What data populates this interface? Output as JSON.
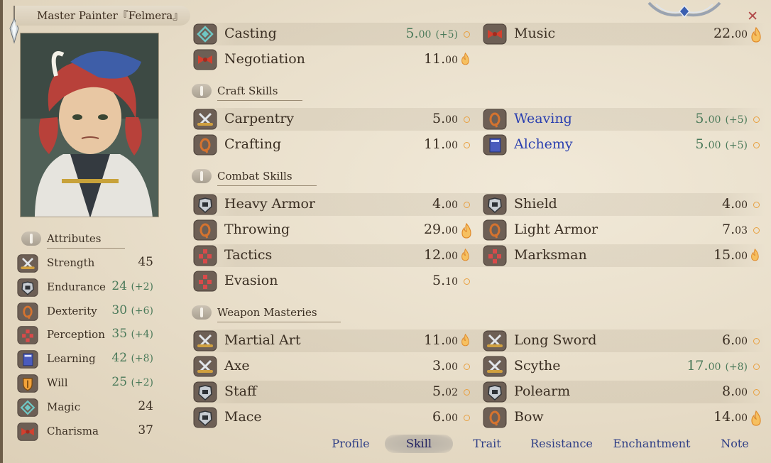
{
  "window": {
    "title": "Master Painter『Felmera』",
    "close_label": "✕"
  },
  "portrait": {
    "name": "character-portrait"
  },
  "attributes": {
    "header": "Attributes",
    "items": [
      {
        "label": "Strength",
        "value": "45",
        "bonus": "",
        "icon": "crossed-swords-icon"
      },
      {
        "label": "Endurance",
        "value": "24",
        "bonus": "(+2)",
        "icon": "armor-icon"
      },
      {
        "label": "Dexterity",
        "value": "30",
        "bonus": "(+6)",
        "icon": "rope-icon"
      },
      {
        "label": "Perception",
        "value": "35",
        "bonus": "(+4)",
        "icon": "target-icon"
      },
      {
        "label": "Learning",
        "value": "42",
        "bonus": "(+8)",
        "icon": "book-icon"
      },
      {
        "label": "Will",
        "value": "25",
        "bonus": "(+2)",
        "icon": "shield-icon"
      },
      {
        "label": "Magic",
        "value": "24",
        "bonus": "",
        "icon": "rune-icon"
      },
      {
        "label": "Charisma",
        "value": "37",
        "bonus": "",
        "icon": "ribbon-icon"
      }
    ]
  },
  "general_skills": [
    {
      "name": "Casting",
      "whole": "5.",
      "dec": "00",
      "bonus": "(+5)",
      "icon": "rune-icon",
      "potential": "low"
    },
    {
      "name": "Music",
      "whole": "22.",
      "dec": "00",
      "bonus": "",
      "icon": "ribbon-icon",
      "potential": "high"
    },
    {
      "name": "Negotiation",
      "whole": "11.",
      "dec": "00",
      "bonus": "",
      "icon": "ribbon-icon",
      "potential": "mid"
    }
  ],
  "sections": {
    "craft": "Craft Skills",
    "combat": "Combat Skills",
    "weapon": "Weapon Masteries"
  },
  "craft_skills": [
    {
      "name": "Carpentry",
      "whole": "5.",
      "dec": "00",
      "bonus": "",
      "icon": "crossed-swords-icon",
      "potential": "low"
    },
    {
      "name": "Weaving",
      "whole": "5.",
      "dec": "00",
      "bonus": "(+5)",
      "icon": "rope-icon",
      "potential": "low",
      "highlight": true
    },
    {
      "name": "Crafting",
      "whole": "11.",
      "dec": "00",
      "bonus": "",
      "icon": "rope-icon",
      "potential": "low"
    },
    {
      "name": "Alchemy",
      "whole": "5.",
      "dec": "00",
      "bonus": "(+5)",
      "icon": "book-icon",
      "potential": "low",
      "highlight": true
    }
  ],
  "combat_skills": [
    {
      "name": "Heavy Armor",
      "whole": "4.",
      "dec": "00",
      "bonus": "",
      "icon": "armor-icon",
      "potential": "low"
    },
    {
      "name": "Shield",
      "whole": "4.",
      "dec": "00",
      "bonus": "",
      "icon": "armor-icon",
      "potential": "low"
    },
    {
      "name": "Throwing",
      "whole": "29.",
      "dec": "00",
      "bonus": "",
      "icon": "rope-icon",
      "potential": "high"
    },
    {
      "name": "Light Armor",
      "whole": "7.",
      "dec": "03",
      "bonus": "",
      "icon": "rope-icon",
      "potential": "low"
    },
    {
      "name": "Tactics",
      "whole": "12.",
      "dec": "00",
      "bonus": "",
      "icon": "target-icon",
      "potential": "mid"
    },
    {
      "name": "Marksman",
      "whole": "15.",
      "dec": "00",
      "bonus": "",
      "icon": "target-icon",
      "potential": "mid"
    },
    {
      "name": "Evasion",
      "whole": "5.",
      "dec": "10",
      "bonus": "",
      "icon": "target-icon",
      "potential": "low"
    }
  ],
  "weapon_skills": [
    {
      "name": "Martial Art",
      "whole": "11.",
      "dec": "00",
      "bonus": "",
      "icon": "crossed-swords-icon",
      "potential": "mid"
    },
    {
      "name": "Long Sword",
      "whole": "6.",
      "dec": "00",
      "bonus": "",
      "icon": "crossed-swords-icon",
      "potential": "low"
    },
    {
      "name": "Axe",
      "whole": "3.",
      "dec": "00",
      "bonus": "",
      "icon": "crossed-swords-icon",
      "potential": "low"
    },
    {
      "name": "Scythe",
      "whole": "17.",
      "dec": "00",
      "bonus": "(+8)",
      "icon": "crossed-swords-icon",
      "potential": "low"
    },
    {
      "name": "Staff",
      "whole": "5.",
      "dec": "02",
      "bonus": "",
      "icon": "armor-icon",
      "potential": "low"
    },
    {
      "name": "Polearm",
      "whole": "8.",
      "dec": "00",
      "bonus": "",
      "icon": "armor-icon",
      "potential": "low"
    },
    {
      "name": "Mace",
      "whole": "6.",
      "dec": "00",
      "bonus": "",
      "icon": "armor-icon",
      "potential": "low"
    },
    {
      "name": "Bow",
      "whole": "14.",
      "dec": "00",
      "bonus": "",
      "icon": "rope-icon",
      "potential": "high"
    }
  ],
  "tabs": [
    {
      "label": "Profile",
      "active": false
    },
    {
      "label": "Skill",
      "active": true
    },
    {
      "label": "Trait",
      "active": false
    },
    {
      "label": "Resistance",
      "active": false
    },
    {
      "label": "Enchantment",
      "active": false
    },
    {
      "label": "Note",
      "active": false
    }
  ],
  "colors": {
    "bonus_green": "#4b7a5a",
    "highlight_blue": "#2a3fb0",
    "tab_blue": "#2f3f86",
    "close_red": "#b04848",
    "flame_orange": "#f0a040"
  }
}
